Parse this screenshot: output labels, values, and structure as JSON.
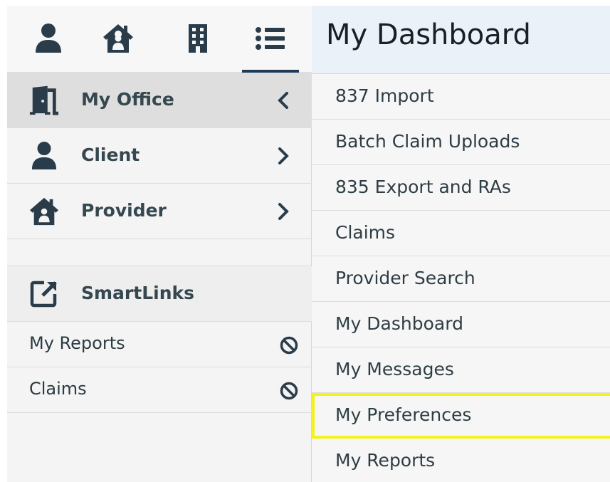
{
  "colors": {
    "navy": "#1f3a57",
    "icon": "#2a3c4a",
    "highlight": "#f5f21a",
    "header_bg": "#eaf1f9"
  },
  "icon_tabs": [
    {
      "icon": "person-icon"
    },
    {
      "icon": "home-icon"
    },
    {
      "icon": "building-icon"
    },
    {
      "icon": "list-icon",
      "active": true
    }
  ],
  "sidebar": {
    "menu": [
      {
        "label": "My Office",
        "icon": "door-icon",
        "chevron": "chevron-left-icon",
        "selected": true
      },
      {
        "label": "Client",
        "icon": "person-icon",
        "chevron": "chevron-right-icon"
      },
      {
        "label": "Provider",
        "icon": "home-icon",
        "chevron": "chevron-right-icon"
      }
    ],
    "smartlinks": {
      "label": "SmartLinks",
      "icon": "external-link-icon"
    },
    "links": [
      {
        "label": "My Reports",
        "icon": "ban-icon"
      },
      {
        "label": "Claims",
        "icon": "ban-icon"
      }
    ]
  },
  "panel": {
    "title": "My Dashboard",
    "items": [
      {
        "label": "837 Import"
      },
      {
        "label": "Batch Claim Uploads"
      },
      {
        "label": "835 Export and RAs"
      },
      {
        "label": "Claims"
      },
      {
        "label": "Provider Search"
      },
      {
        "label": "My Dashboard"
      },
      {
        "label": "My Messages"
      },
      {
        "label": "My Preferences",
        "highlighted": true
      },
      {
        "label": "My Reports"
      }
    ]
  }
}
